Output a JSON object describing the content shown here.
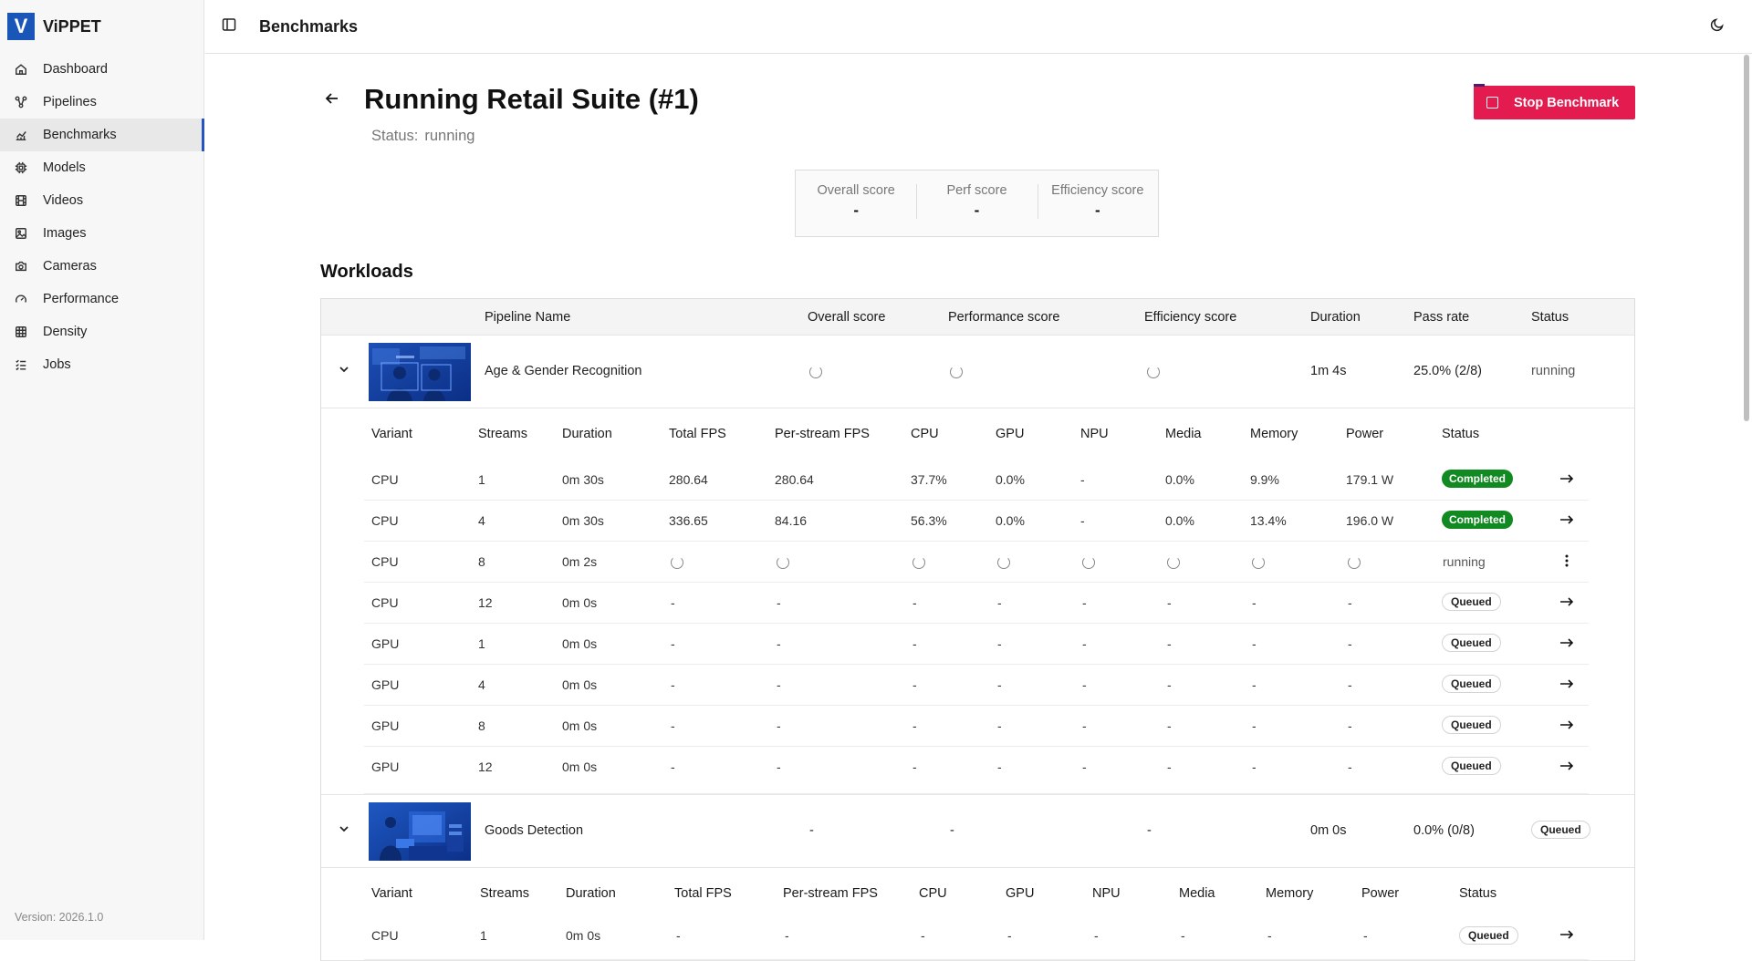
{
  "app": {
    "name": "ViPPET",
    "logo_letter": "V",
    "version": "Version: 2026.1.0"
  },
  "colors": {
    "brand": "#1a55b8",
    "danger": "#e31b4e",
    "success": "#118a21",
    "active_indicator": "#2553c2"
  },
  "sidebar": {
    "items": [
      {
        "label": "Dashboard",
        "icon": "home-icon"
      },
      {
        "label": "Pipelines",
        "icon": "pipeline-icon"
      },
      {
        "label": "Benchmarks",
        "icon": "chart-icon",
        "active": true
      },
      {
        "label": "Models",
        "icon": "chip-icon"
      },
      {
        "label": "Videos",
        "icon": "film-icon"
      },
      {
        "label": "Images",
        "icon": "image-icon"
      },
      {
        "label": "Cameras",
        "icon": "camera-icon"
      },
      {
        "label": "Performance",
        "icon": "gauge-icon"
      },
      {
        "label": "Density",
        "icon": "grid-icon"
      },
      {
        "label": "Jobs",
        "icon": "list-icon"
      }
    ]
  },
  "topbar": {
    "title": "Benchmarks"
  },
  "page": {
    "title": "Running Retail Suite (#1)",
    "status_label": "Status:",
    "status_value": "running",
    "stop_button": "Stop Benchmark",
    "section_title": "Workloads"
  },
  "scores": [
    {
      "label": "Overall score",
      "value": "-"
    },
    {
      "label": "Perf score",
      "value": "-"
    },
    {
      "label": "Efficiency score",
      "value": "-"
    }
  ],
  "workload_headers": [
    "Pipeline Name",
    "Overall score",
    "Performance score",
    "Efficiency score",
    "Duration",
    "Pass rate",
    "Status"
  ],
  "variant_headers": [
    "Variant",
    "Streams",
    "Duration",
    "Total FPS",
    "Per-stream FPS",
    "CPU",
    "GPU",
    "NPU",
    "Media",
    "Memory",
    "Power",
    "Status"
  ],
  "workloads": [
    {
      "name": "Age & Gender Recognition",
      "overall": "",
      "performance": "",
      "efficiency": "",
      "duration": "1m 4s",
      "pass_rate": "25.0% (2/8)",
      "status": "running",
      "variants": [
        {
          "variant": "CPU",
          "streams": "1",
          "duration": "0m 30s",
          "total_fps": "280.64",
          "per_stream_fps": "280.64",
          "cpu": "37.7%",
          "gpu": "0.0%",
          "npu": "-",
          "media": "0.0%",
          "memory": "9.9%",
          "power": "179.1 W",
          "status": "Completed"
        },
        {
          "variant": "CPU",
          "streams": "4",
          "duration": "0m 30s",
          "total_fps": "336.65",
          "per_stream_fps": "84.16",
          "cpu": "56.3%",
          "gpu": "0.0%",
          "npu": "-",
          "media": "0.0%",
          "memory": "13.4%",
          "power": "196.0 W",
          "status": "Completed"
        },
        {
          "variant": "CPU",
          "streams": "8",
          "duration": "0m 2s",
          "status": "running",
          "loading": true
        },
        {
          "variant": "CPU",
          "streams": "12",
          "duration": "0m 0s",
          "total_fps": "-",
          "per_stream_fps": "-",
          "cpu": "-",
          "gpu": "-",
          "npu": "-",
          "media": "-",
          "memory": "-",
          "power": "-",
          "status": "Queued"
        },
        {
          "variant": "GPU",
          "streams": "1",
          "duration": "0m 0s",
          "total_fps": "-",
          "per_stream_fps": "-",
          "cpu": "-",
          "gpu": "-",
          "npu": "-",
          "media": "-",
          "memory": "-",
          "power": "-",
          "status": "Queued"
        },
        {
          "variant": "GPU",
          "streams": "4",
          "duration": "0m 0s",
          "total_fps": "-",
          "per_stream_fps": "-",
          "cpu": "-",
          "gpu": "-",
          "npu": "-",
          "media": "-",
          "memory": "-",
          "power": "-",
          "status": "Queued"
        },
        {
          "variant": "GPU",
          "streams": "8",
          "duration": "0m 0s",
          "total_fps": "-",
          "per_stream_fps": "-",
          "cpu": "-",
          "gpu": "-",
          "npu": "-",
          "media": "-",
          "memory": "-",
          "power": "-",
          "status": "Queued"
        },
        {
          "variant": "GPU",
          "streams": "12",
          "duration": "0m 0s",
          "total_fps": "-",
          "per_stream_fps": "-",
          "cpu": "-",
          "gpu": "-",
          "npu": "-",
          "media": "-",
          "memory": "-",
          "power": "-",
          "status": "Queued"
        }
      ]
    },
    {
      "name": "Goods Detection",
      "overall": "-",
      "performance": "-",
      "efficiency": "-",
      "duration": "0m 0s",
      "pass_rate": "0.0% (0/8)",
      "status": "Queued",
      "variants": [
        {
          "variant": "CPU",
          "streams": "1",
          "duration": "0m 0s",
          "total_fps": "-",
          "per_stream_fps": "-",
          "cpu": "-",
          "gpu": "-",
          "npu": "-",
          "media": "-",
          "memory": "-",
          "power": "-",
          "status": "Queued"
        }
      ]
    }
  ]
}
